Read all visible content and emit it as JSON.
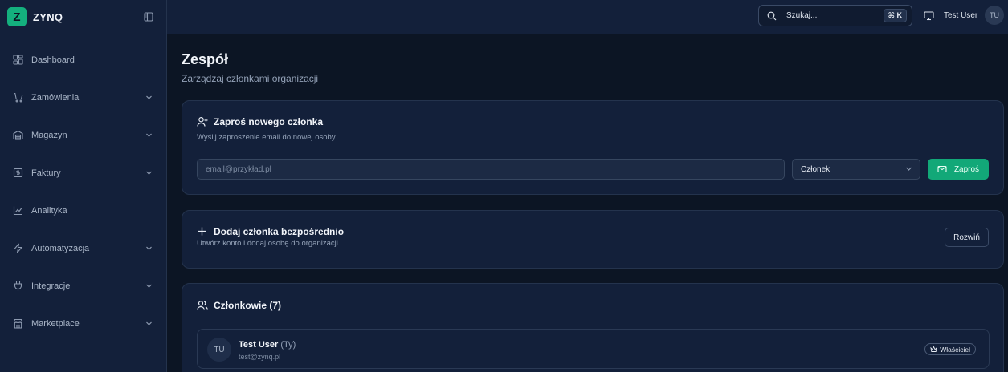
{
  "brand": {
    "logo_letter": "Z",
    "name": "ZYNQ",
    "accent": "#14b07e"
  },
  "sidebar": {
    "items": [
      {
        "label": "Dashboard",
        "icon": "grid-icon",
        "has_submenu": false
      },
      {
        "label": "Zamówienia",
        "icon": "cart-icon",
        "has_submenu": true
      },
      {
        "label": "Magazyn",
        "icon": "warehouse-icon",
        "has_submenu": true
      },
      {
        "label": "Faktury",
        "icon": "invoice-icon",
        "has_submenu": true
      },
      {
        "label": "Analityka",
        "icon": "chart-line-icon",
        "has_submenu": false
      },
      {
        "label": "Automatyzacja",
        "icon": "zap-icon",
        "has_submenu": true
      },
      {
        "label": "Integracje",
        "icon": "plug-icon",
        "has_submenu": true
      },
      {
        "label": "Marketplace",
        "icon": "store-icon",
        "has_submenu": true
      }
    ]
  },
  "topbar": {
    "search_text": "Szukaj...",
    "shortcut": "⌘ K",
    "user_name": "Test User",
    "user_initials": "TU"
  },
  "page": {
    "title": "Zespół",
    "subtitle": "Zarządzaj członkami organizacji"
  },
  "invite": {
    "title": "Zaproś nowego członka",
    "description": "Wyślij zaproszenie email do nowej osoby",
    "email_placeholder": "email@przykład.pl",
    "email_value": "",
    "role_selected": "Członek",
    "button_label": "Zaproś"
  },
  "add_direct": {
    "title": "Dodaj członka bezpośrednio",
    "description": "Utwórz konto i dodaj osobę do organizacji",
    "button_label": "Rozwiń"
  },
  "members": {
    "title": "Członkowie (7)",
    "list": [
      {
        "initials": "TU",
        "name": "Test User",
        "you_label": "(Ty)",
        "email": "test@zynq.pl",
        "role": "Właściciel"
      }
    ]
  }
}
